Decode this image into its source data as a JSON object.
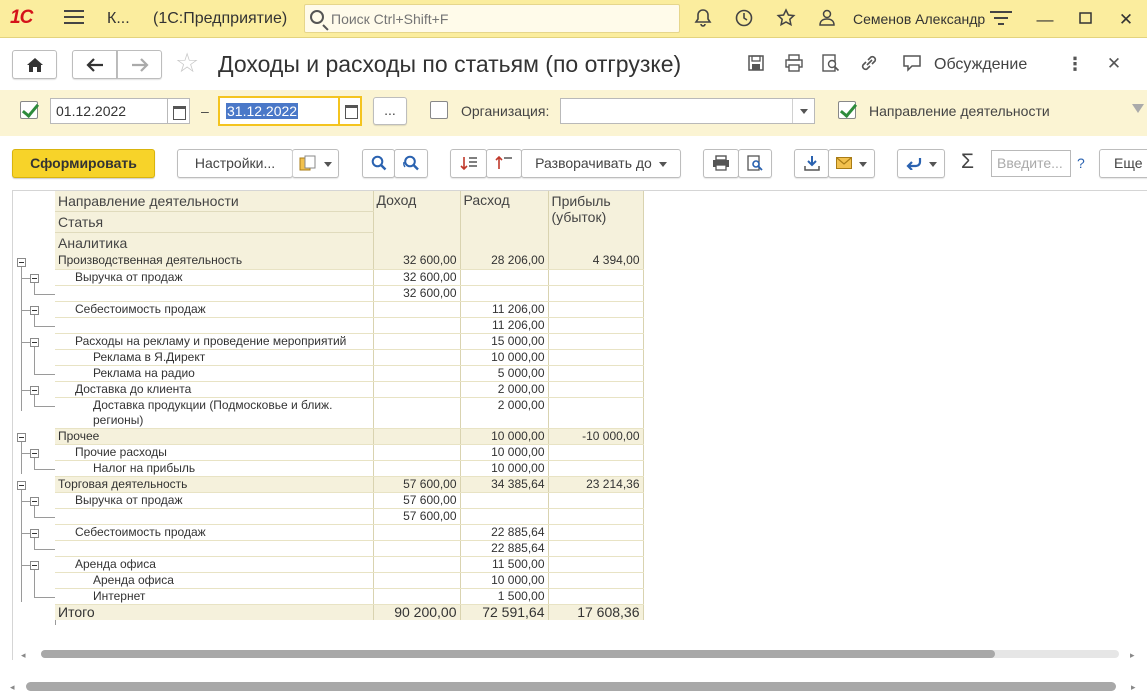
{
  "topbar": {
    "logo": "1С",
    "short_title": "К...",
    "app_title": "(1С:Предприятие)",
    "search_placeholder": "Поиск Ctrl+Shift+F",
    "user": "Семенов Александр"
  },
  "titlebar": {
    "title": "Доходы и расходы по статьям (по отгрузке)",
    "discussion_label": "Обсуждение"
  },
  "filters": {
    "period_enabled": true,
    "date_from": "01.12.2022",
    "date_sep": "–",
    "date_to": "31.12.2022",
    "more_label": "...",
    "org_enabled": false,
    "org_label": "Организация:",
    "org_value": "",
    "direction_enabled": true,
    "direction_label": "Направление деятельности"
  },
  "toolbar": {
    "generate": "Сформировать",
    "settings": "Настройки...",
    "expand_to": "Разворачивать до",
    "search_placeholder": "Введите...",
    "help": "?",
    "more": "Еще",
    "sigma": "Σ"
  },
  "report": {
    "headers": {
      "grouping": [
        "Направление деятельности",
        "Статья",
        "Аналитика"
      ],
      "income": "Доход",
      "expense": "Расход",
      "profit": "Прибыль (убыток)"
    },
    "rows": [
      {
        "level": 0,
        "name": "Производственная деятельность",
        "income": "32 600,00",
        "expense": "28 206,00",
        "profit": "4 394,00"
      },
      {
        "level": 1,
        "name": "Выручка от продаж",
        "income": "32 600,00",
        "expense": "",
        "profit": ""
      },
      {
        "level": 2,
        "name": "",
        "income": "32 600,00",
        "expense": "",
        "profit": ""
      },
      {
        "level": 1,
        "name": "Себестоимость продаж",
        "income": "",
        "expense": "11 206,00",
        "profit": ""
      },
      {
        "level": 2,
        "name": "",
        "income": "",
        "expense": "11 206,00",
        "profit": ""
      },
      {
        "level": 1,
        "name": "Расходы на рекламу и проведение мероприятий",
        "income": "",
        "expense": "15 000,00",
        "profit": ""
      },
      {
        "level": 2,
        "name": "Реклама в Я.Директ",
        "income": "",
        "expense": "10 000,00",
        "profit": ""
      },
      {
        "level": 2,
        "name": "Реклама на радио",
        "income": "",
        "expense": "5 000,00",
        "profit": ""
      },
      {
        "level": 1,
        "name": "Доставка до клиента",
        "income": "",
        "expense": "2 000,00",
        "profit": ""
      },
      {
        "level": 3,
        "name": "Доставка продукции (Подмосковье и ближ. регионы)",
        "income": "",
        "expense": "2 000,00",
        "profit": ""
      },
      {
        "level": 0,
        "name": "Прочее",
        "income": "",
        "expense": "10 000,00",
        "profit": "-10 000,00"
      },
      {
        "level": 1,
        "name": "Прочие расходы",
        "income": "",
        "expense": "10 000,00",
        "profit": ""
      },
      {
        "level": 2,
        "name": "Налог на прибыль",
        "income": "",
        "expense": "10 000,00",
        "profit": ""
      },
      {
        "level": 0,
        "name": "Торговая деятельность",
        "income": "57 600,00",
        "expense": "34 385,64",
        "profit": "23 214,36"
      },
      {
        "level": 1,
        "name": "Выручка от продаж",
        "income": "57 600,00",
        "expense": "",
        "profit": ""
      },
      {
        "level": 2,
        "name": "",
        "income": "57 600,00",
        "expense": "",
        "profit": ""
      },
      {
        "level": 1,
        "name": "Себестоимость продаж",
        "income": "",
        "expense": "22 885,64",
        "profit": ""
      },
      {
        "level": 2,
        "name": "",
        "income": "",
        "expense": "22 885,64",
        "profit": ""
      },
      {
        "level": 1,
        "name": "Аренда офиса",
        "income": "",
        "expense": "11 500,00",
        "profit": ""
      },
      {
        "level": 2,
        "name": "Аренда офиса",
        "income": "",
        "expense": "10 000,00",
        "profit": ""
      },
      {
        "level": 2,
        "name": "Интернет",
        "income": "",
        "expense": "1 500,00",
        "profit": ""
      }
    ],
    "total": {
      "name": "Итого",
      "income": "90 200,00",
      "expense": "72 591,64",
      "profit": "17 608,36"
    }
  },
  "colors": {
    "topbar": "#fbed9e",
    "filterbar": "#fbf4d3",
    "primary_button": "#f7d329",
    "group_row": "#f5f1dc",
    "check": "#2e8b3b"
  }
}
